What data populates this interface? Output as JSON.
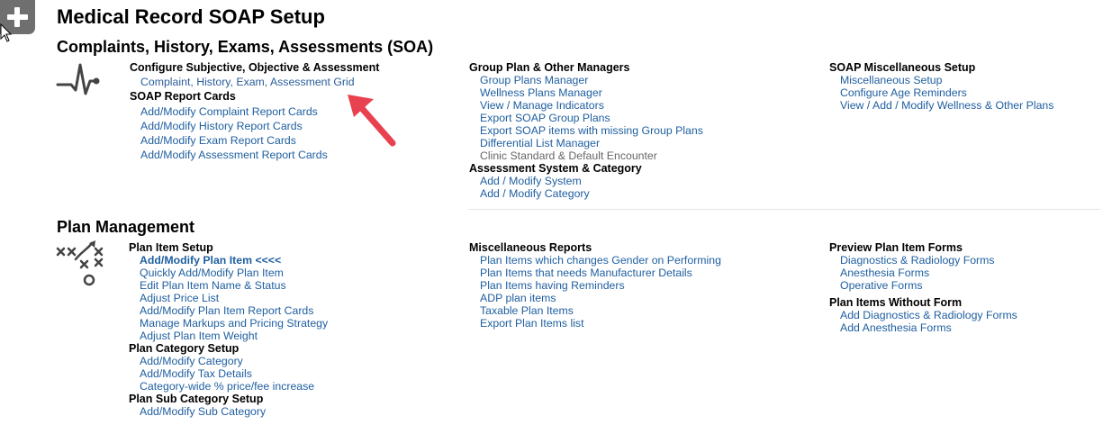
{
  "header": {
    "title": "Medical Record SOAP Setup"
  },
  "soa": {
    "title": "Complaints, History, Exams, Assessments (SOA)",
    "col1": {
      "configure_heading": "Configure Subjective, Objective & Assessment",
      "configure_links": [
        "Complaint, History, Exam, Assessment Grid"
      ],
      "report_heading": "SOAP Report Cards",
      "report_links": [
        "Add/Modify Complaint Report Cards",
        "Add/Modify History Report Cards",
        "Add/Modify Exam Report Cards",
        "Add/Modify Assessment Report Cards"
      ]
    },
    "col2": {
      "managers_heading": "Group Plan & Other Managers",
      "managers_links": [
        "Group Plans Manager",
        "Wellness Plans Manager",
        "View / Manage Indicators",
        "Export SOAP Group Plans",
        "Export SOAP items with missing Group Plans",
        "Differential List Manager",
        "Clinic Standard & Default Encounter"
      ],
      "system_heading": "Assessment System & Category",
      "system_links": [
        "Add / Modify System",
        "Add / Modify Category"
      ]
    },
    "col3": {
      "misc_heading": "SOAP Miscellaneous Setup",
      "misc_links": [
        "Miscellaneous Setup",
        "Configure Age Reminders",
        "View / Add / Modify Wellness & Other Plans"
      ]
    }
  },
  "plan": {
    "title": "Plan Management",
    "col1": {
      "item_heading": "Plan Item Setup",
      "item_links": [
        "Add/Modify Plan Item <<<<",
        "Quickly Add/Modify Plan Item",
        "Edit Plan Item Name & Status",
        "Adjust Price List",
        "Add/Modify Plan Item Report Cards",
        "Manage Markups and Pricing Strategy",
        "Adjust Plan Item Weight"
      ],
      "category_heading": "Plan Category Setup",
      "category_links": [
        "Add/Modify Category",
        "Add/Modify Tax Details",
        "Category-wide % price/fee increase"
      ],
      "subcategory_heading": "Plan Sub Category Setup",
      "subcategory_links": [
        "Add/Modify Sub Category"
      ]
    },
    "col2": {
      "reports_heading": "Miscellaneous Reports",
      "reports_links": [
        "Plan Items which changes Gender on Performing",
        "Plan Items that needs Manufacturer Details",
        "Plan Items having Reminders",
        "ADP plan items",
        "Taxable Plan Items",
        "Export Plan Items list"
      ]
    },
    "col3": {
      "preview_heading": "Preview Plan Item Forms",
      "preview_links": [
        "Diagnostics & Radiology Forms",
        "Anesthesia Forms",
        "Operative Forms"
      ],
      "without_heading": "Plan Items Without Form",
      "without_links": [
        "Add Diagnostics & Radiology Forms",
        "Add Anesthesia Forms"
      ]
    }
  },
  "colors": {
    "link": "#1f5fa0",
    "gray_link": "#666666",
    "arrow": "#e8414f",
    "button_bg": "#6f6f6f"
  },
  "icons": {
    "add_button": "plus-icon",
    "soa_section": "heartbeat-icon",
    "plan_section": "strategy-play-icon",
    "annotation": "red-arrow-icon",
    "cursor": "mouse-pointer-icon"
  }
}
